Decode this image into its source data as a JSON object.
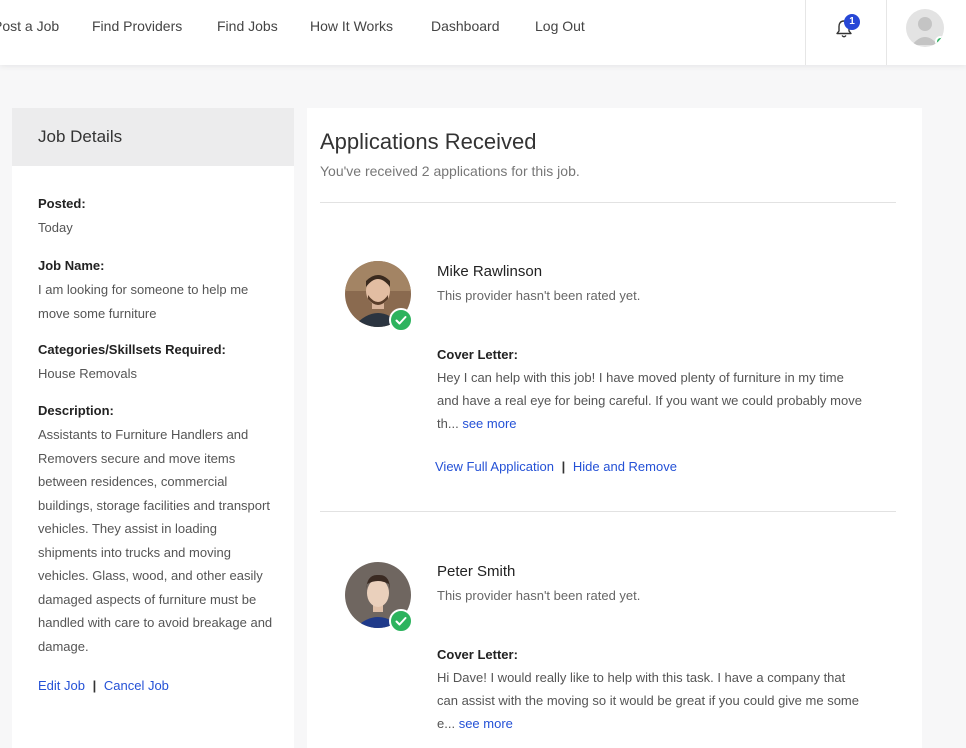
{
  "nav": {
    "items": [
      "Post a Job",
      "Find Providers",
      "Find Jobs",
      "How It Works",
      "Dashboard",
      "Log Out"
    ],
    "notification_count": "1"
  },
  "job_details": {
    "heading": "Job Details",
    "posted_label": "Posted:",
    "posted_value": "Today",
    "name_label": "Job Name:",
    "name_value": "I am looking for someone to help me move some furniture",
    "categories_label": "Categories/Skillsets Required:",
    "categories_value": "House Removals",
    "description_label": "Description:",
    "description_value": "Assistants to Furniture Handlers and Removers secure and move items between residences, commercial buildings, storage facilities and transport vehicles. They assist in loading shipments into trucks and moving vehicles. Glass, wood, and other easily damaged aspects of furniture must be handled with care to avoid breakage and damage.",
    "edit_label": "Edit Job",
    "separator": "|",
    "cancel_label": "Cancel Job"
  },
  "applications": {
    "title": "Applications Received",
    "subtitle": "You've received 2 applications for this job.",
    "items": [
      {
        "name": "Mike Rawlinson",
        "rating": "This provider hasn't been rated yet.",
        "cover_label": "Cover Letter:",
        "cover_text": "Hey I can help with this job! I have moved plenty of furniture in my time and have a real eye for being careful. If you want we could probably move th...",
        "see_more": "see more",
        "view_label": "View Full Application",
        "separator": "|",
        "hide_label": "Hide and Remove"
      },
      {
        "name": "Peter Smith",
        "rating": "This provider hasn't been rated yet.",
        "cover_label": "Cover Letter:",
        "cover_text": "Hi Dave! I would really like to help with this task. I have a company that can assist with the moving so it would be great if you could give me some e...",
        "see_more": "see more"
      }
    ]
  },
  "colors": {
    "link": "#2451d6",
    "badge": "#2747d6",
    "verified": "#2db35e"
  }
}
